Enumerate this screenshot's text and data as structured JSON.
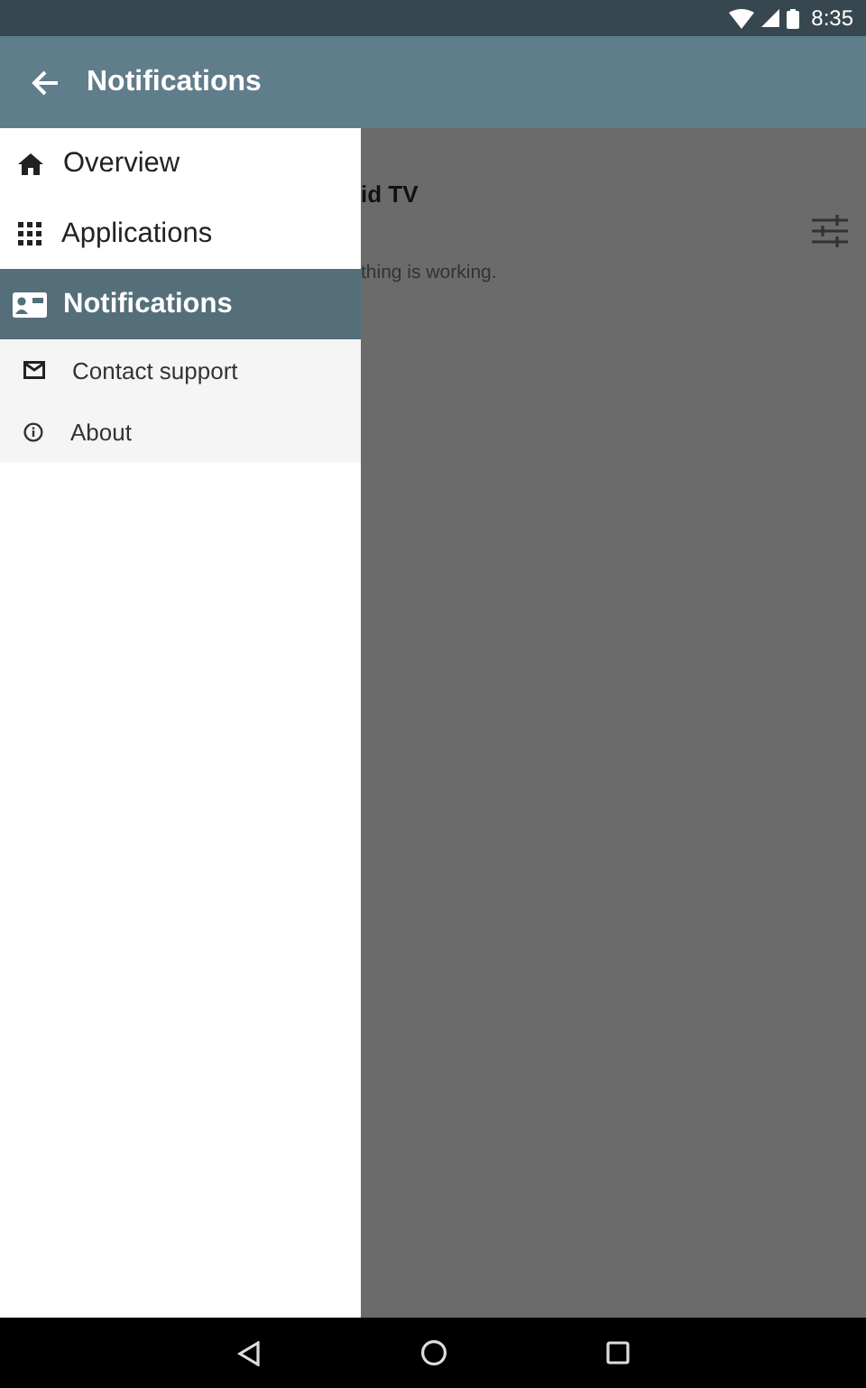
{
  "status_bar": {
    "time": "8:35"
  },
  "app_bar": {
    "title": "Notifications"
  },
  "drawer": {
    "items": [
      {
        "label": "Overview",
        "kind": "primary",
        "selected": false
      },
      {
        "label": "Applications",
        "kind": "primary",
        "selected": false
      },
      {
        "label": "Notifications",
        "kind": "primary",
        "selected": true
      },
      {
        "label": "Contact support",
        "kind": "secondary",
        "selected": false
      },
      {
        "label": "About",
        "kind": "secondary",
        "selected": false
      }
    ]
  },
  "content": {
    "title": "id TV",
    "message": "thing is working."
  }
}
